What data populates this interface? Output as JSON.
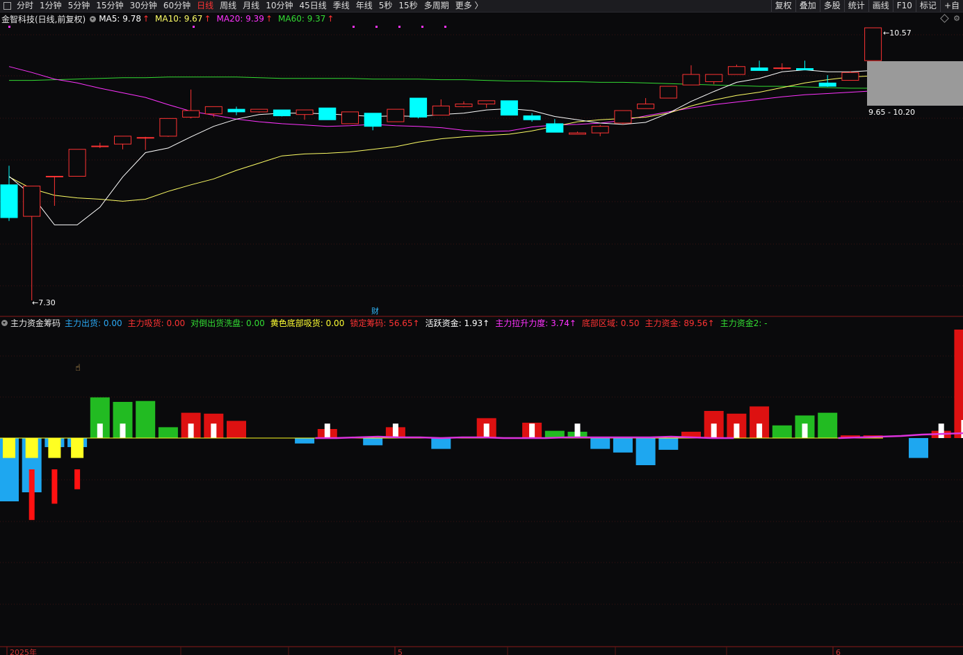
{
  "toolbar": {
    "periods": [
      "分时",
      "1分钟",
      "5分钟",
      "15分钟",
      "30分钟",
      "60分钟",
      "日线",
      "周线",
      "月线",
      "10分钟",
      "45日线",
      "季线",
      "年线",
      "5秒",
      "15秒",
      "多周期",
      "更多 〉"
    ],
    "active_period": "日线",
    "right_buttons": [
      "复权",
      "叠加",
      "多股",
      "统计",
      "画线",
      "F10",
      "标记",
      "+自"
    ]
  },
  "main_legend": {
    "title": "金智科技(日线,前复权)",
    "ma5": "MA5: 9.78",
    "ma10": "MA10: 9.67",
    "ma20": "MA20: 9.39",
    "ma60": "MA60: 9.37",
    "arrow": "↑"
  },
  "price_labels": {
    "high": "10.57",
    "low": "7.30",
    "range": "9.65 - 10.20",
    "cai_marker": "财"
  },
  "indicator_legend": {
    "name": "主力资金筹码",
    "items": [
      {
        "text": "主力出货: 0.00",
        "color": "#2aa9f5",
        "arrow": false
      },
      {
        "text": "主力吸货: 0.00",
        "color": "#ff3333",
        "arrow": false
      },
      {
        "text": "对倒出货洗盘: 0.00",
        "color": "#33dd33",
        "arrow": false
      },
      {
        "text": "黄色底部吸货: 0.00",
        "color": "#ffff33",
        "arrow": false
      },
      {
        "text": "锁定筹码: 56.65",
        "color": "#ff3333",
        "arrow": true
      },
      {
        "text": "活跃资金: 1.93",
        "color": "#ffffff",
        "arrow": true
      },
      {
        "text": "主力拉升力度: 3.74",
        "color": "#ff33ff",
        "arrow": true
      },
      {
        "text": "底部区域: 0.50",
        "color": "#ff3333",
        "arrow": false
      },
      {
        "text": "主力资金: 89.56",
        "color": "#ff3333",
        "arrow": true
      },
      {
        "text": "主力资金2: -",
        "color": "#33dd33",
        "arrow": false
      }
    ]
  },
  "time_axis": {
    "labels": [
      "2025年",
      "5",
      "6"
    ]
  },
  "colors": {
    "up": "#ff3333",
    "down": "#00ffff",
    "ma5": "#ffffff",
    "ma10": "#ffff66",
    "ma20": "#ff33ff",
    "ma60": "#33dd33",
    "grid": "#3a1010"
  },
  "chart_data": [
    {
      "type": "candlestick",
      "title": "金智科技(日线,前复权)",
      "series_fields": [
        "open",
        "high",
        "low",
        "close"
      ],
      "candles": [
        [
          9.06,
          9.35,
          8.51,
          8.56
        ],
        [
          8.58,
          8.76,
          7.3,
          9.04
        ],
        [
          9.19,
          9.19,
          8.74,
          9.19
        ],
        [
          9.19,
          9.6,
          9.19,
          9.6
        ],
        [
          9.65,
          9.7,
          9.62,
          9.65
        ],
        [
          9.68,
          9.8,
          9.6,
          9.8
        ],
        [
          9.78,
          9.79,
          9.59,
          9.78
        ],
        [
          9.8,
          10.07,
          9.79,
          10.07
        ],
        [
          10.09,
          10.51,
          10.07,
          10.19
        ],
        [
          10.14,
          10.25,
          10.09,
          10.25
        ],
        [
          10.21,
          10.25,
          10.12,
          10.17
        ],
        [
          10.17,
          10.21,
          10.16,
          10.21
        ],
        [
          10.2,
          10.2,
          10.1,
          10.11
        ],
        [
          10.13,
          10.2,
          10.05,
          10.2
        ],
        [
          10.23,
          10.23,
          10.05,
          10.05
        ],
        [
          9.99,
          10.17,
          9.99,
          10.17
        ],
        [
          10.15,
          10.15,
          9.89,
          9.95
        ],
        [
          10.02,
          10.21,
          10.02,
          10.21
        ],
        [
          10.38,
          10.38,
          10.07,
          10.09
        ],
        [
          10.12,
          10.36,
          10.12,
          10.26
        ],
        [
          10.25,
          10.33,
          10.24,
          10.29
        ],
        [
          10.29,
          10.34,
          10.23,
          10.34
        ],
        [
          10.34,
          10.34,
          10.12,
          10.12
        ],
        [
          10.11,
          10.15,
          10.02,
          10.05
        ],
        [
          9.99,
          10.06,
          9.86,
          9.86
        ],
        [
          9.83,
          9.87,
          9.83,
          9.85
        ],
        [
          9.85,
          9.97,
          9.8,
          9.95
        ],
        [
          10.0,
          10.19,
          9.98,
          10.19
        ],
        [
          10.22,
          10.38,
          10.22,
          10.29
        ],
        [
          10.38,
          10.56,
          10.38,
          10.56
        ],
        [
          10.58,
          10.88,
          10.58,
          10.74
        ],
        [
          10.63,
          10.74,
          10.59,
          10.74
        ],
        [
          10.74,
          10.89,
          10.74,
          10.86
        ],
        [
          10.84,
          10.95,
          10.82,
          10.8
        ],
        [
          10.84,
          10.91,
          10.81,
          10.84
        ],
        [
          10.83,
          10.95,
          10.82,
          10.81
        ],
        [
          10.61,
          10.73,
          10.55,
          10.56
        ],
        [
          10.65,
          10.79,
          10.65,
          10.77
        ],
        [
          10.95,
          11.45,
          10.95,
          11.45
        ]
      ],
      "ma5": [
        9.19,
        8.9,
        8.45,
        8.45,
        8.72,
        9.18,
        9.55,
        9.62,
        9.79,
        9.95,
        10.06,
        10.13,
        10.15,
        10.15,
        10.14,
        10.12,
        10.1,
        10.11,
        10.1,
        10.13,
        10.15,
        10.2,
        10.22,
        10.19,
        10.1,
        10.05,
        10.0,
        9.98,
        10.01,
        10.15,
        10.33,
        10.48,
        10.62,
        10.68,
        10.78,
        10.81,
        10.78,
        10.78,
        10.8,
        10.93
      ],
      "ma10": [
        9.18,
        9.0,
        8.9,
        8.86,
        8.84,
        8.81,
        8.84,
        8.96,
        9.06,
        9.15,
        9.28,
        9.39,
        9.5,
        9.53,
        9.54,
        9.56,
        9.6,
        9.64,
        9.71,
        9.76,
        9.79,
        9.81,
        9.83,
        9.88,
        9.95,
        10.02,
        10.05,
        10.07,
        10.09,
        10.15,
        10.26,
        10.35,
        10.42,
        10.47,
        10.54,
        10.61,
        10.66,
        10.7,
        10.72,
        10.79
      ],
      "ma20": [
        10.86,
        10.77,
        10.67,
        10.61,
        10.53,
        10.46,
        10.39,
        10.28,
        10.18,
        10.12,
        10.06,
        10.02,
        9.99,
        9.97,
        9.95,
        9.96,
        9.98,
        9.96,
        9.95,
        9.93,
        9.89,
        9.87,
        9.88,
        9.94,
        9.97,
        9.98,
        10.0,
        10.04,
        10.11,
        10.17,
        10.23,
        10.28,
        10.32,
        10.36,
        10.4,
        10.43,
        10.45,
        10.47,
        10.49,
        10.53
      ],
      "ma60": [
        10.65,
        10.65,
        10.66,
        10.67,
        10.68,
        10.69,
        10.69,
        10.7,
        10.7,
        10.7,
        10.7,
        10.69,
        10.68,
        10.68,
        10.68,
        10.68,
        10.67,
        10.67,
        10.67,
        10.66,
        10.66,
        10.65,
        10.64,
        10.64,
        10.63,
        10.63,
        10.62,
        10.62,
        10.61,
        10.6,
        10.59,
        10.58,
        10.57,
        10.56,
        10.56,
        10.55,
        10.54,
        10.53,
        10.53
      ],
      "annotations": {
        "high": 10.57,
        "low": 7.3,
        "range": "9.65 - 10.20"
      }
    },
    {
      "type": "bar",
      "title": "主力资金筹码",
      "values": [
        -70,
        -60,
        -10,
        -10,
        45,
        40,
        41,
        12,
        28,
        27,
        19,
        0,
        0,
        -6,
        10,
        0,
        -8,
        12,
        0,
        -12,
        0,
        22,
        0,
        17,
        8,
        7,
        -12,
        -16,
        -30,
        -13,
        7,
        30,
        27,
        35,
        14,
        25,
        28,
        3,
        3,
        0,
        -22,
        8,
        120
      ],
      "inner_bars": [
        0,
        0,
        0,
        0,
        16,
        16,
        0,
        0,
        16,
        16,
        0,
        0,
        0,
        0,
        16,
        0,
        0,
        16,
        0,
        0,
        0,
        16,
        0,
        16,
        0,
        16,
        0,
        0,
        0,
        0,
        0,
        16,
        16,
        16,
        0,
        16,
        0,
        0,
        0,
        0,
        0,
        16,
        20
      ],
      "yellow_bars": [
        -22,
        -22,
        -22,
        -22,
        0,
        0,
        0,
        0,
        0,
        0,
        0,
        0,
        0,
        0,
        0,
        0,
        0,
        0,
        0,
        0,
        0,
        0,
        0,
        0,
        0,
        0,
        0,
        0,
        0,
        0,
        0,
        0,
        0,
        0,
        0,
        0,
        0,
        0,
        0,
        0,
        0,
        0,
        0
      ],
      "red_sticks": [
        0,
        -56,
        -38,
        -22,
        0,
        0,
        0,
        0,
        0,
        0,
        0,
        0,
        0,
        0,
        0,
        0,
        0,
        0,
        0,
        0,
        0,
        0,
        0,
        0,
        0,
        0,
        0,
        0,
        0,
        0,
        0,
        0,
        0,
        0,
        0,
        0,
        0,
        0,
        0,
        0,
        0,
        0,
        0
      ],
      "line": [
        null,
        null,
        null,
        null,
        null,
        null,
        null,
        0,
        0,
        1,
        2,
        1,
        1,
        0,
        1,
        1,
        0,
        0,
        0,
        1,
        1,
        1,
        1,
        1,
        2,
        1,
        0,
        0,
        null,
        null,
        null,
        null,
        0,
        1,
        2,
        3,
        5,
        6,
        7,
        6,
        5,
        3,
        1,
        1,
        2,
        12
      ]
    }
  ]
}
